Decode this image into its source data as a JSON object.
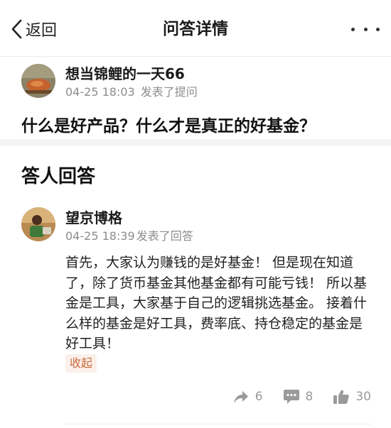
{
  "nav": {
    "back_label": "返回",
    "title": "问答详情"
  },
  "question": {
    "author_name": "想当锦鲤的一天66",
    "timestamp": "04-25 18:03",
    "action_text": "发表了提问",
    "text": "什么是好产品？什么才是真正的好基金？"
  },
  "answers": {
    "section_title": "答人回答",
    "items": [
      {
        "author_name": "望京博格",
        "timestamp": "04-25 18:39",
        "action_text": "发表了回答",
        "body": "首先，大家认为赚钱的是好基金！ 但是现在知道了，除了货币基金其他基金都有可能亏钱！ 所以基金是工具，大家基于自己的逻辑挑选基金。 接着什么样的基金是好工具，费率底、持仓稳定的基金是好工具！",
        "collapse_label": "收起",
        "share_count": "6",
        "comment_count": "8",
        "like_count": "30"
      }
    ]
  },
  "icons": {
    "back": "chevron-left-icon",
    "more": "more-dots-icon",
    "share": "share-arrow-icon",
    "comment": "comment-bubble-icon",
    "like": "thumbs-up-icon"
  },
  "colors": {
    "accent": "#c86a3c",
    "accent_bg": "#fbf0ea",
    "muted": "#8c8c8c",
    "icon_gray": "#9a9a9a"
  }
}
